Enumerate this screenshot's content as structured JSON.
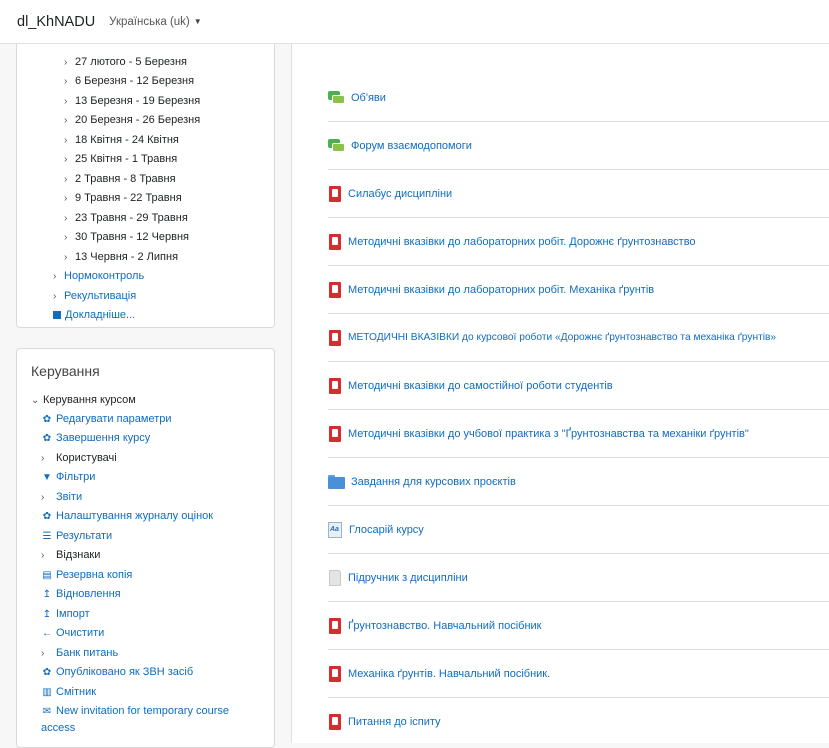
{
  "navbar": {
    "brand": "dl_KhNADU",
    "language": "Українська (uk)"
  },
  "nav_tree": {
    "weeks": [
      "27 лютого - 5 Березня",
      "6 Березня - 12 Березня",
      "13 Березня - 19 Березня",
      "20 Березня - 26 Березня",
      "18 Квітня - 24 Квітня",
      "25 Квітня - 1 Травня",
      "2 Травня - 8 Травня",
      "9 Травня - 22 Травня",
      "23 Травня - 29 Травня",
      "30 Травня - 12 Червня",
      "13 Червня - 2 Липня"
    ],
    "courses": [
      "Нормоконтроль",
      "Рекультивація"
    ],
    "more": "Докладніше..."
  },
  "admin": {
    "title": "Керування",
    "section": "Керування курсом",
    "items": [
      {
        "label": "Редагувати параметри",
        "icon": "gear-icon",
        "kind": "link"
      },
      {
        "label": "Завершення курсу",
        "icon": "gear-icon",
        "kind": "link"
      },
      {
        "label": "Користувачі",
        "icon": "chevron-right-icon",
        "kind": "branch"
      },
      {
        "label": "Фільтри",
        "icon": "filter-icon",
        "kind": "link"
      },
      {
        "label": "Звіти",
        "icon": "chevron-right-icon",
        "kind": "branch-link"
      },
      {
        "label": "Налаштування журналу оцінок",
        "icon": "gear-icon",
        "kind": "link"
      },
      {
        "label": "Результати",
        "icon": "table-icon",
        "kind": "link"
      },
      {
        "label": "Відзнаки",
        "icon": "chevron-right-icon",
        "kind": "branch"
      },
      {
        "label": "Резервна копія",
        "icon": "file-icon",
        "kind": "link"
      },
      {
        "label": "Відновлення",
        "icon": "upload-icon",
        "kind": "link"
      },
      {
        "label": "Імпорт",
        "icon": "upload-icon",
        "kind": "link"
      },
      {
        "label": "Очистити",
        "icon": "arrow-left-icon",
        "kind": "link"
      },
      {
        "label": "Банк питань",
        "icon": "chevron-right-icon",
        "kind": "branch-link"
      },
      {
        "label": "Опубліковано як ЗВН засіб",
        "icon": "gear-icon",
        "kind": "link"
      },
      {
        "label": "Смітник",
        "icon": "trash-icon",
        "kind": "link"
      },
      {
        "label": "New invitation for temporary course",
        "icon": "envelope-icon",
        "kind": "link"
      },
      {
        "label": "access",
        "icon": "",
        "kind": "link"
      }
    ]
  },
  "activities": [
    {
      "label": "Об'яви",
      "icon": "forum-icon"
    },
    {
      "label": "Форум взаємодопомоги",
      "icon": "forum-icon"
    },
    {
      "label": "Силабус дисципліни",
      "icon": "pdf-icon"
    },
    {
      "label": "Методичні вказівки до лабораторних робіт. Дорожнє ґрунтознавство",
      "icon": "pdf-icon"
    },
    {
      "label": "Методичні вказівки до лабораторних робіт. Механіка ґрунтів",
      "icon": "pdf-icon"
    },
    {
      "label": "МЕТОДИЧНІ ВКАЗІВКИ до курсової роботи «Дорожнє ґрунтознавство та механіка ґрунтів»",
      "icon": "pdf-icon"
    },
    {
      "label": "Методичні вказівки до самостійної роботи студентів",
      "icon": "pdf-icon"
    },
    {
      "label": "Методичні вказівки до учбової практика з \"Ґрунтознавства та механіки ґрунтів\"",
      "icon": "pdf-icon"
    },
    {
      "label": "Завдання для курсових проєктів",
      "icon": "folder-icon"
    },
    {
      "label": "Глосарій курсу",
      "icon": "glossary-icon"
    },
    {
      "label": "Підручник з дисципліни",
      "icon": "book-icon"
    },
    {
      "label": "Ґрунтознавство. Навчальний посібник",
      "icon": "pdf-icon"
    },
    {
      "label": "Механіка ґрунтів. Навчальний посібник.",
      "icon": "pdf-icon"
    },
    {
      "label": "Питання до іспиту",
      "icon": "pdf-icon"
    }
  ]
}
